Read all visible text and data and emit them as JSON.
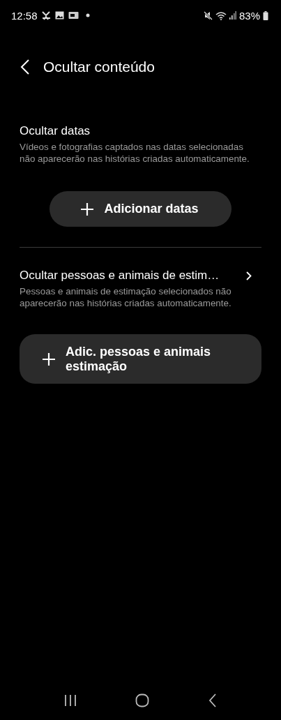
{
  "status_bar": {
    "time": "12:58",
    "battery": "83%"
  },
  "header": {
    "title": "Ocultar conteúdo"
  },
  "sections": [
    {
      "title": "Ocultar datas",
      "chevron": false,
      "description": "Vídeos e fotografias captados nas datas selecionadas não aparecerão nas histórias criadas automaticamente.",
      "button": {
        "label": "Adicionar datas",
        "kind": "compact"
      }
    },
    {
      "title": "Ocultar pessoas e animais de estim…",
      "chevron": true,
      "description": "Pessoas e animais de estimação selecionados não aparecerão nas histórias criadas automaticamente.",
      "button": {
        "label": "Adic. pessoas e animais estimação",
        "kind": "wide"
      }
    }
  ]
}
